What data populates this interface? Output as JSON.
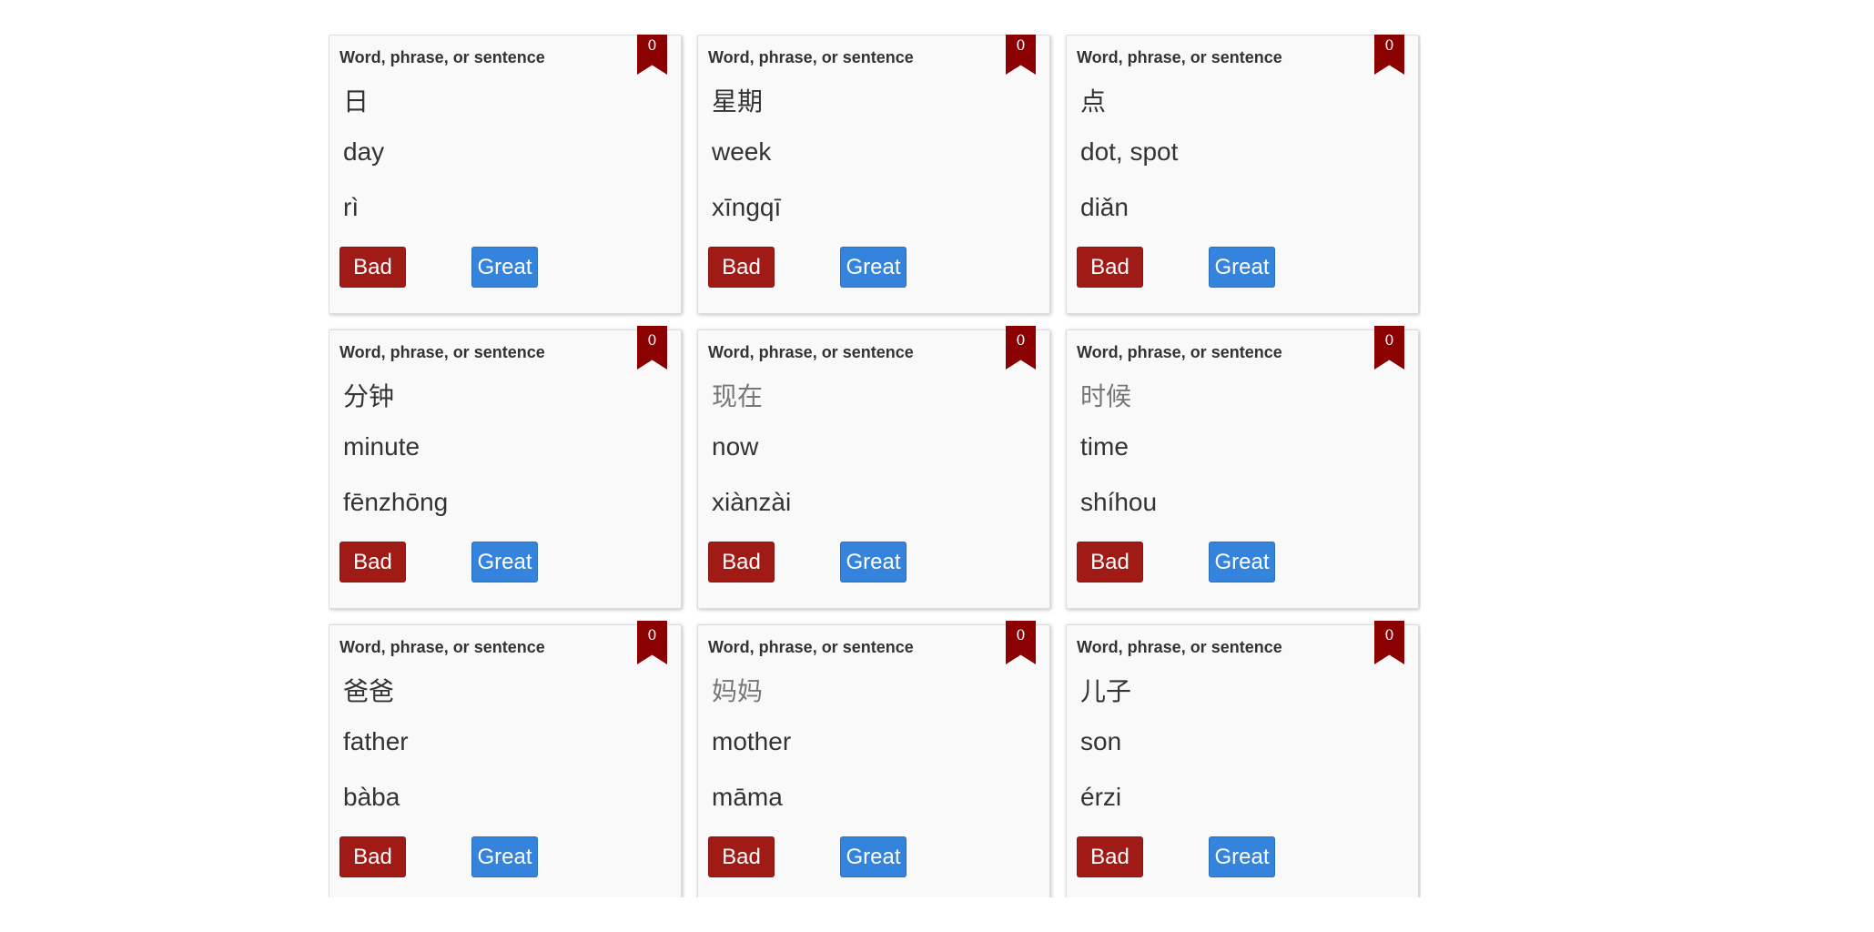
{
  "card_label": "Word, phrase, or sentence",
  "buttons": {
    "bad": "Bad",
    "great": "Great"
  },
  "colors": {
    "ribbon": "#8b0000",
    "bad": "#a01a16",
    "great": "#3483dc"
  },
  "cards": [
    {
      "count": "0",
      "chinese": "日",
      "english": "day",
      "pinyin": "rì"
    },
    {
      "count": "0",
      "chinese": "星期",
      "english": "week",
      "pinyin": "xīngqī"
    },
    {
      "count": "0",
      "chinese": "点",
      "english": "dot, spot",
      "pinyin": "diǎn"
    },
    {
      "count": "0",
      "chinese": "分钟",
      "english": "minute",
      "pinyin": "fēnzhōng"
    },
    {
      "count": "0",
      "chinese": "现在",
      "english": "now",
      "pinyin": "xiànzài"
    },
    {
      "count": "0",
      "chinese": "时候",
      "english": "time",
      "pinyin": "shíhou"
    },
    {
      "count": "0",
      "chinese": "爸爸",
      "english": "father",
      "pinyin": "bàba"
    },
    {
      "count": "0",
      "chinese": "妈妈",
      "english": "mother",
      "pinyin": "māma"
    },
    {
      "count": "0",
      "chinese": "儿子",
      "english": "son",
      "pinyin": "érzi"
    }
  ]
}
